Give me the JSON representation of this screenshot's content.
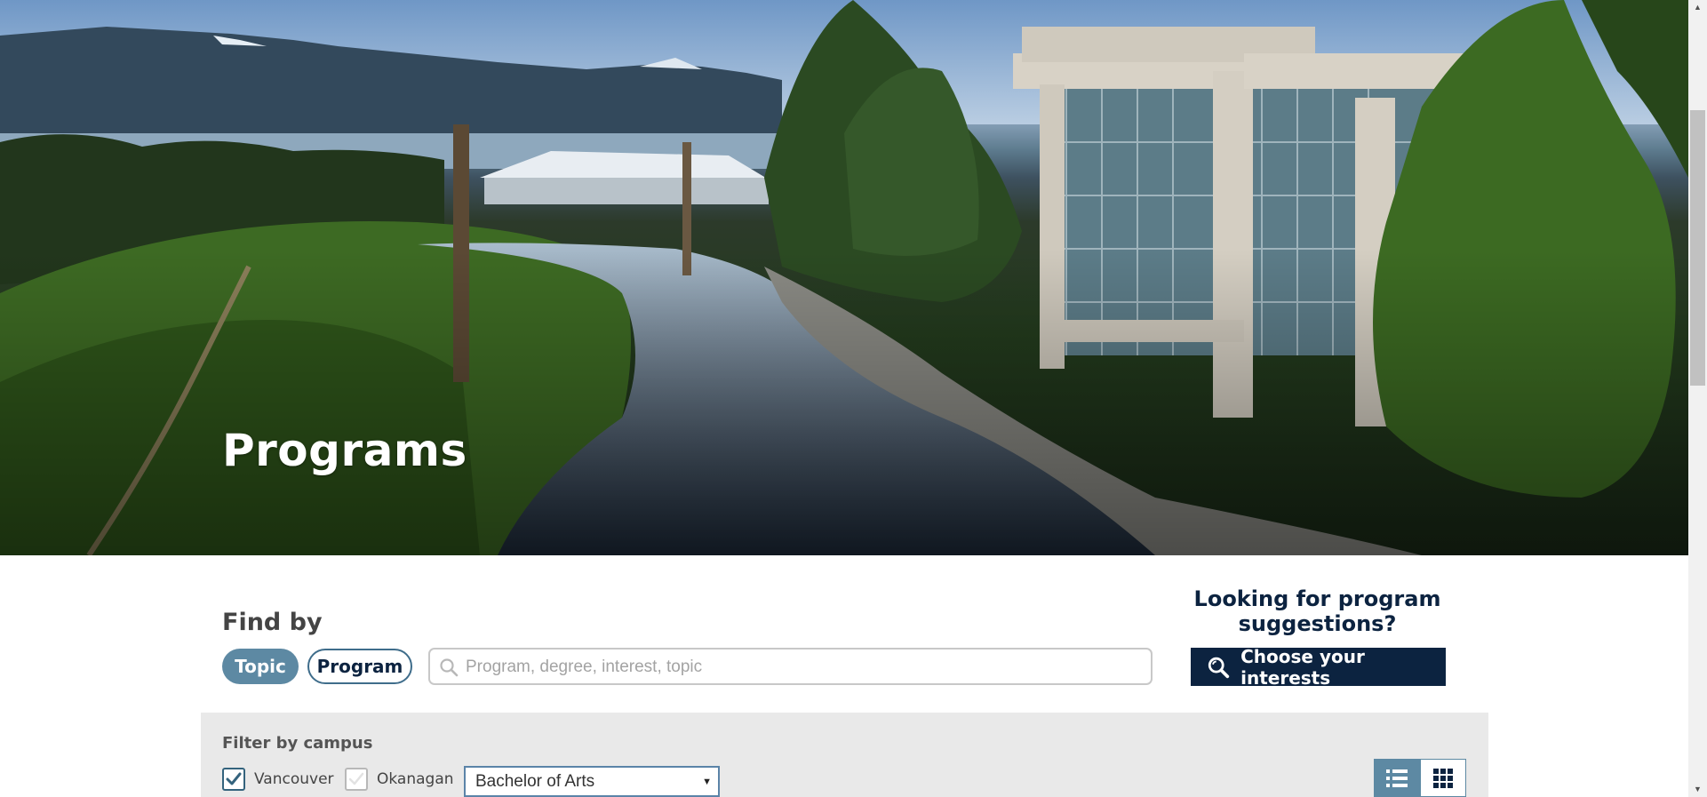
{
  "hero": {
    "title": "Programs"
  },
  "find": {
    "title": "Find by",
    "tabs": [
      {
        "label": "Topic",
        "active": true
      },
      {
        "label": "Program",
        "active": false
      }
    ],
    "search": {
      "placeholder": "Program, degree, interest, topic",
      "value": ""
    }
  },
  "suggestions": {
    "title": "Looking for program suggestions?",
    "button_label": "Choose your interests",
    "button_icon": "search-interests-icon"
  },
  "filter": {
    "label": "Filter by campus",
    "campuses": [
      {
        "label": "Vancouver",
        "checked": true
      },
      {
        "label": "Okanagan",
        "checked": false
      }
    ],
    "degree_select": {
      "value": "Bachelor of Arts"
    },
    "view_modes": [
      {
        "name": "list-view",
        "icon": "list-icon",
        "active": true
      },
      {
        "name": "grid-view",
        "icon": "grid-icon",
        "active": false
      }
    ]
  },
  "colors": {
    "navy": "#0c2340",
    "steel_blue": "#5d89a3",
    "panel_gray": "#e9e9e9"
  }
}
